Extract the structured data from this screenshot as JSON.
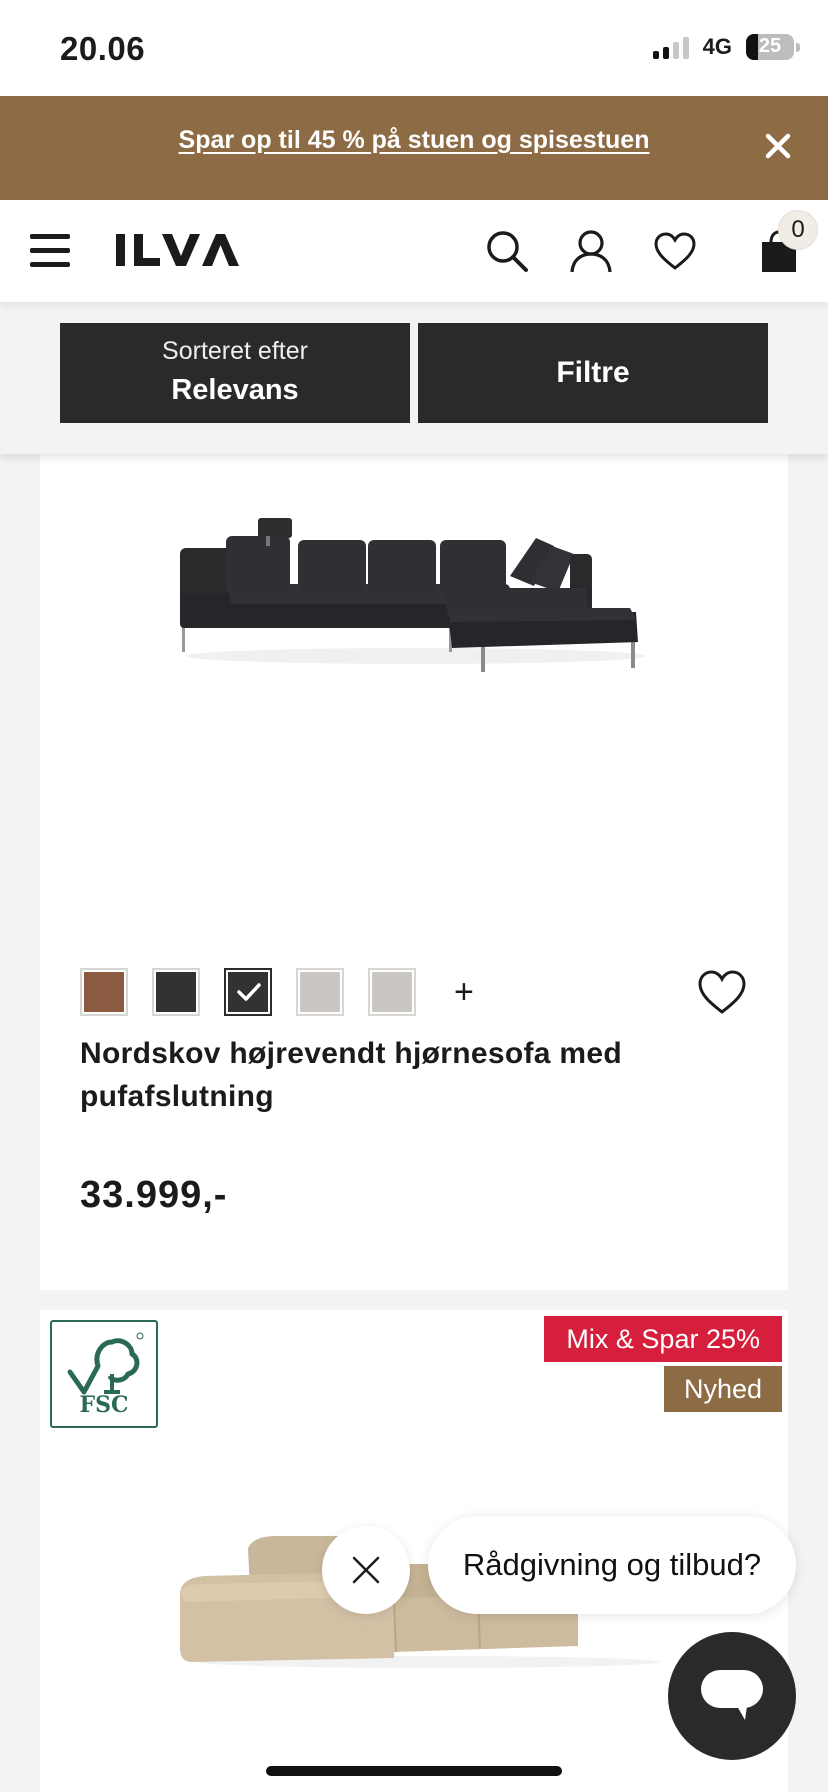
{
  "status_bar": {
    "time": "20.06",
    "network": "4G",
    "battery": "25"
  },
  "promo": {
    "text": "Spar op til 45 % på stuen og spisestuen"
  },
  "header": {
    "logo_text": "ILVA",
    "cart_count": "0"
  },
  "sort": {
    "label": "Sorteret efter",
    "value": "Relevans"
  },
  "filter": {
    "label": "Filtre"
  },
  "products": [
    {
      "title": "Nordskov højrevendt hjørnesofa med pufafslutning",
      "price": "33.999,-",
      "swatches": [
        "#8a5a42",
        "#323235",
        "#323235",
        "#c8c5c3",
        "#c8c5c3"
      ],
      "selected_swatch": 2,
      "more_swatches": "+"
    },
    {
      "badges": {
        "sale": "Mix & Spar 25%",
        "new": "Nyhed"
      },
      "certification_text": "FSC"
    }
  ],
  "chat": {
    "prompt": "Rådgivning og tilbud?"
  },
  "colors": {
    "promo_bg": "#8d6b45",
    "button_bg": "#2b2a2a",
    "sale_red": "#d61f3c",
    "fsc_green": "#2a6a55"
  }
}
